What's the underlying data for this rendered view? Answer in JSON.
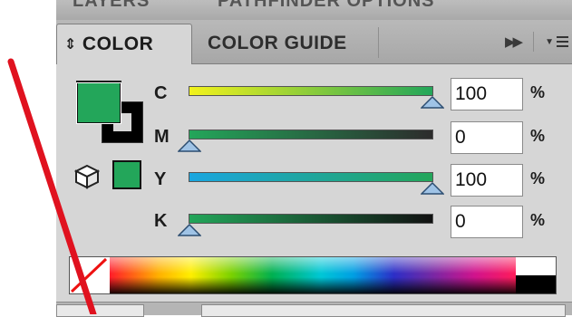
{
  "window": {
    "cutoff_title_left": "LAYERS",
    "cutoff_title_right": "PATHFINDER OPTIONS"
  },
  "tabs": [
    {
      "label": "COLOR",
      "icon": "diamond-arrows-icon",
      "active": true
    },
    {
      "label": "COLOR GUIDE",
      "active": false
    }
  ],
  "toolbar": {
    "expand_icon": "fast-forward-icon",
    "menu_icon": "panel-menu-icon"
  },
  "swatches": {
    "fill_color": "#23a65a",
    "stroke_color": "#000000",
    "websafe_color": "#23a65a"
  },
  "channels": [
    {
      "label": "C",
      "value": "100",
      "unit": "%",
      "level": 1.0,
      "gradient": [
        "#f2f21c",
        "#23a65a"
      ]
    },
    {
      "label": "M",
      "value": "0",
      "unit": "%",
      "level": 0.0,
      "gradient": [
        "#23a65a",
        "#2c2c2c"
      ]
    },
    {
      "label": "Y",
      "value": "100",
      "unit": "%",
      "level": 1.0,
      "gradient": [
        "#1aa6e0",
        "#23a65a"
      ]
    },
    {
      "label": "K",
      "value": "0",
      "unit": "%",
      "level": 0.0,
      "gradient": [
        "#23a65a",
        "#111111"
      ]
    }
  ],
  "colors": {
    "panel_bg": "#d6d6d6",
    "thumb": "#9fc3e6"
  }
}
